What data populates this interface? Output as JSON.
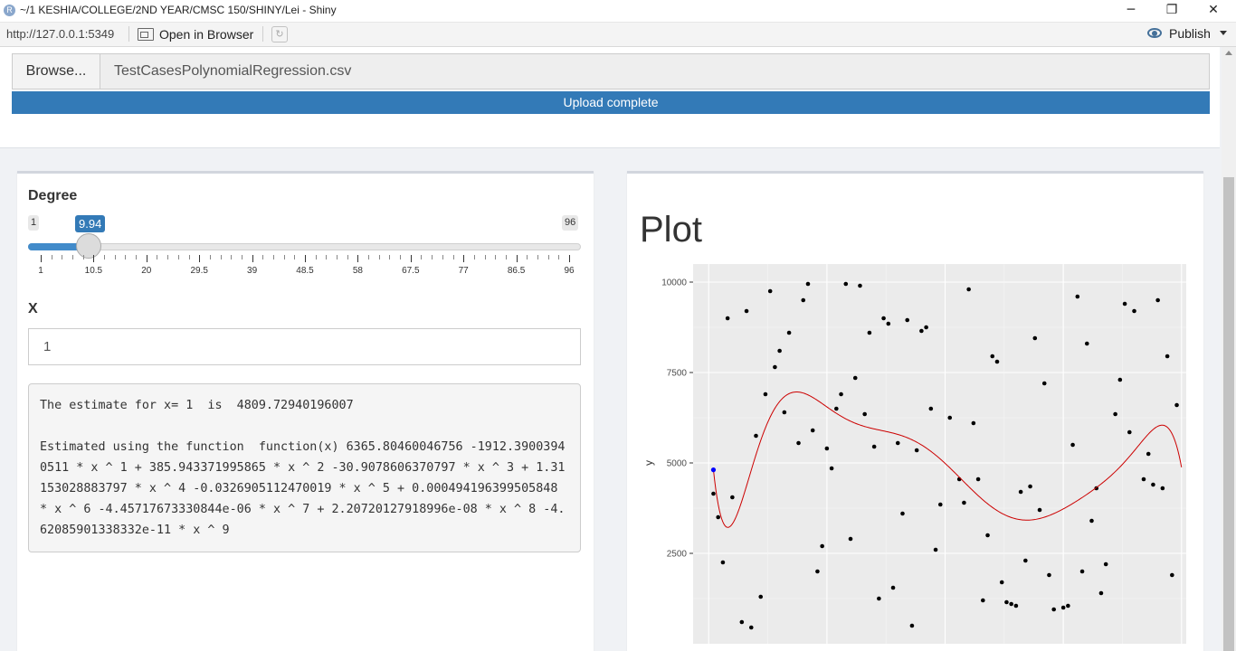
{
  "window": {
    "title": "~/1 KESHIA/COLLEGE/2ND YEAR/CMSC 150/SHINY/Lei - Shiny",
    "logo_letter": "R",
    "minimize": "─",
    "restore": "❐",
    "close": "✕"
  },
  "toolbar": {
    "url": "http://127.0.0.1:5349",
    "open_browser_label": "Open in Browser",
    "publish_label": "Publish"
  },
  "upload": {
    "browse_label": "Browse...",
    "file_name": "TestCasesPolynomialRegression.csv",
    "progress_label": "Upload complete",
    "progress_value": 100
  },
  "degree": {
    "label": "Degree",
    "min": 1,
    "max": 96,
    "value": 9.94,
    "min_label": "1",
    "max_label": "96",
    "value_label": "9.94",
    "tick_labels": [
      "1",
      "10.5",
      "20",
      "29.5",
      "39",
      "48.5",
      "58",
      "67.5",
      "77",
      "86.5",
      "96"
    ]
  },
  "x_input": {
    "label": "X",
    "value": "1"
  },
  "result": {
    "line1": "The estimate for x= 1  is  4809.72940196007",
    "line2": "Estimated using the function  function(x) 6365.80460046756 -1912.39003940511 * x ^ 1 + 385.943371995865 * x ^ 2 -30.9078606370797 * x ^ 3 + 1.31153028883797 * x ^ 4 -0.0326905112470019 * x ^ 5 + 0.000494196399505848 * x ^ 6 -4.45717673330844e-06 * x ^ 7 + 2.20720127918996e-08 * x ^ 8 -4.62085901338332e-11 * x ^ 9"
  },
  "plot_panel": {
    "title": "Plot"
  },
  "chart_data": {
    "type": "scatter",
    "ylabel": "y",
    "xlabel": "",
    "yticks": [
      2500,
      5000,
      7500,
      10000
    ],
    "xlim": [
      -3.3,
      101
    ],
    "ylim": [
      0,
      10500
    ],
    "grid": true,
    "point_color": "#000000",
    "highlight_color": "#0000ff",
    "curve_color": "#cc0000",
    "panel_bg": "#ebebeb",
    "highlight_point": {
      "x": 1,
      "y": 4810
    },
    "points": [
      [
        1,
        4150
      ],
      [
        2,
        3500
      ],
      [
        3,
        2250
      ],
      [
        4,
        9000
      ],
      [
        5,
        4050
      ],
      [
        7,
        600
      ],
      [
        8,
        9200
      ],
      [
        9,
        450
      ],
      [
        10,
        5750
      ],
      [
        11,
        1300
      ],
      [
        12,
        6900
      ],
      [
        13,
        9750
      ],
      [
        14,
        7650
      ],
      [
        15,
        8100
      ],
      [
        16,
        6400
      ],
      [
        17,
        8600
      ],
      [
        19,
        5550
      ],
      [
        20,
        9500
      ],
      [
        21,
        9950
      ],
      [
        22,
        5900
      ],
      [
        23,
        2000
      ],
      [
        24,
        2700
      ],
      [
        25,
        5400
      ],
      [
        26,
        4850
      ],
      [
        27,
        6500
      ],
      [
        28,
        6900
      ],
      [
        29,
        9950
      ],
      [
        30,
        2900
      ],
      [
        31,
        7350
      ],
      [
        32,
        9900
      ],
      [
        33,
        6350
      ],
      [
        34,
        8600
      ],
      [
        35,
        5450
      ],
      [
        36,
        1250
      ],
      [
        37,
        9000
      ],
      [
        38,
        8850
      ],
      [
        39,
        1550
      ],
      [
        40,
        5550
      ],
      [
        41,
        3600
      ],
      [
        42,
        8950
      ],
      [
        43,
        500
      ],
      [
        44,
        5350
      ],
      [
        45,
        8650
      ],
      [
        46,
        8750
      ],
      [
        47,
        6500
      ],
      [
        48,
        2600
      ],
      [
        49,
        3850
      ],
      [
        51,
        6250
      ],
      [
        53,
        4550
      ],
      [
        54,
        3900
      ],
      [
        55,
        9800
      ],
      [
        56,
        6100
      ],
      [
        57,
        4550
      ],
      [
        58,
        1200
      ],
      [
        59,
        3000
      ],
      [
        60,
        7950
      ],
      [
        61,
        7800
      ],
      [
        62,
        1700
      ],
      [
        63,
        1150
      ],
      [
        64,
        1100
      ],
      [
        65,
        1050
      ],
      [
        66,
        4200
      ],
      [
        67,
        2300
      ],
      [
        68,
        4350
      ],
      [
        69,
        8450
      ],
      [
        70,
        3700
      ],
      [
        71,
        7200
      ],
      [
        72,
        1900
      ],
      [
        73,
        950
      ],
      [
        75,
        1000
      ],
      [
        76,
        1050
      ],
      [
        77,
        5500
      ],
      [
        78,
        9600
      ],
      [
        79,
        2000
      ],
      [
        80,
        8300
      ],
      [
        81,
        3400
      ],
      [
        82,
        4300
      ],
      [
        83,
        1400
      ],
      [
        84,
        2200
      ],
      [
        86,
        6350
      ],
      [
        87,
        7300
      ],
      [
        88,
        9400
      ],
      [
        89,
        5850
      ],
      [
        90,
        9200
      ],
      [
        92,
        4550
      ],
      [
        93,
        5250
      ],
      [
        94,
        4400
      ],
      [
        95,
        9500
      ],
      [
        96,
        4300
      ],
      [
        97,
        7950
      ],
      [
        98,
        1900
      ],
      [
        99,
        6600
      ]
    ],
    "fit_coefficients": [
      6365.80460046756,
      -1912.39003940511,
      385.943371995865,
      -30.9078606370797,
      1.31153028883797,
      -0.0326905112470019,
      0.000494196399505848,
      -4.45717673330844e-06,
      2.20720127918996e-08,
      -4.62085901338332e-11
    ]
  }
}
